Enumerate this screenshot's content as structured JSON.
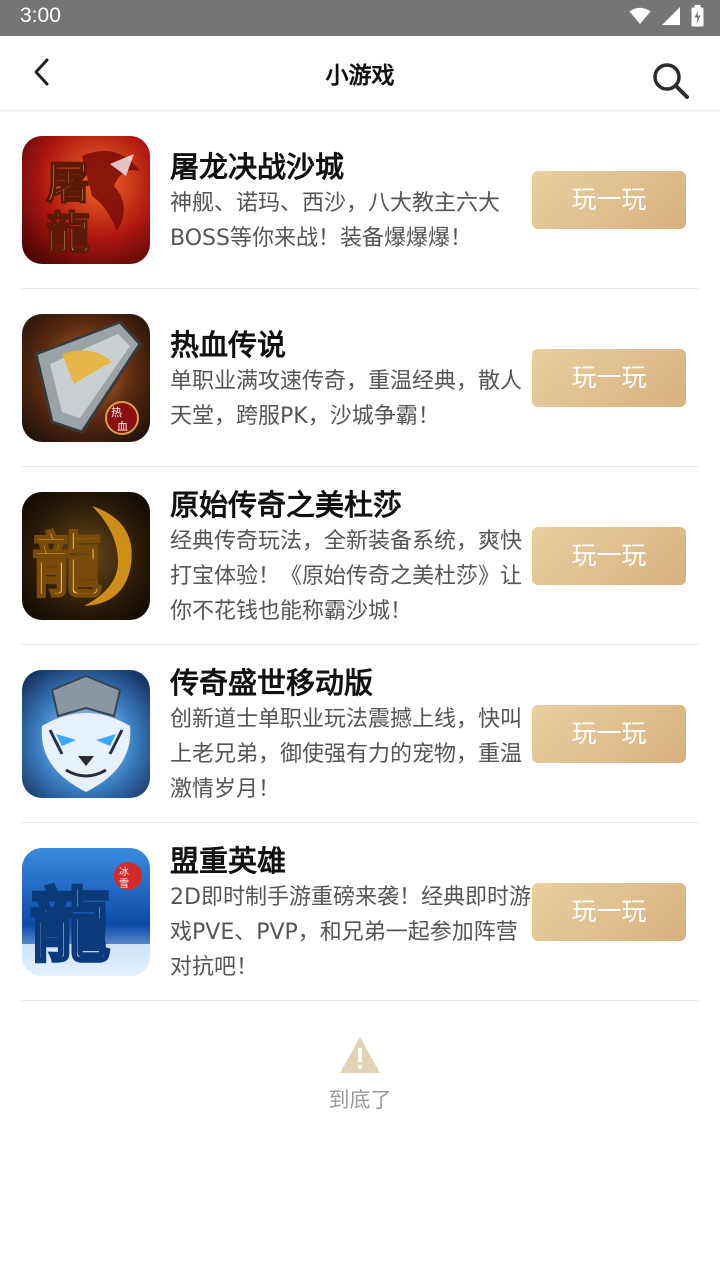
{
  "status_bar": {
    "time": "3:00",
    "icons": [
      "wifi-icon",
      "cellular-signal-icon",
      "battery-charging-icon"
    ]
  },
  "header": {
    "title": "小游戏",
    "back_icon": "chevron-left-icon",
    "search_icon": "search-icon"
  },
  "games": [
    {
      "name": "屠龙决战沙城",
      "description": "神舰、诺玛、西沙，八大教主六大BOSS等你来战！装备爆爆爆！",
      "button": "玩一玩",
      "icon_text": "屠龍",
      "icon_colors": [
        "#8f0f0c",
        "#e24a21"
      ]
    },
    {
      "name": "热血传说",
      "description": "单职业满攻速传奇，重温经典，散人天堂，跨服PK，沙城争霸！",
      "button": "玩一玩",
      "icon_text": "热血",
      "icon_colors": [
        "#1b1410",
        "#7a3a12"
      ]
    },
    {
      "name": "原始传奇之美杜莎",
      "description": "经典传奇玩法，全新装备系统，爽快打宝体验！《原始传奇之美杜莎》让你不花钱也能称霸沙城！",
      "button": "玩一玩",
      "icon_text": "龍",
      "icon_colors": [
        "#160e07",
        "#5c3b12"
      ]
    },
    {
      "name": "传奇盛世移动版",
      "description": "创新道士单职业玩法震撼上线，快叫上老兄弟，御使强有力的宠物，重温激情岁月！",
      "button": "玩一玩",
      "icon_text": "",
      "icon_colors": [
        "#0c2450",
        "#6fb3e8"
      ]
    },
    {
      "name": "盟重英雄",
      "description": "2D即时制手游重磅来袭！经典即时游戏PVE、PVP，和兄弟一起参加阵营对抗吧！",
      "button": "玩一玩",
      "icon_text": "龍",
      "icon_colors": [
        "#0b3f8c",
        "#bfe3ff"
      ]
    }
  ],
  "end_tip": {
    "icon": "warning-triangle-icon",
    "text": "到底了"
  }
}
